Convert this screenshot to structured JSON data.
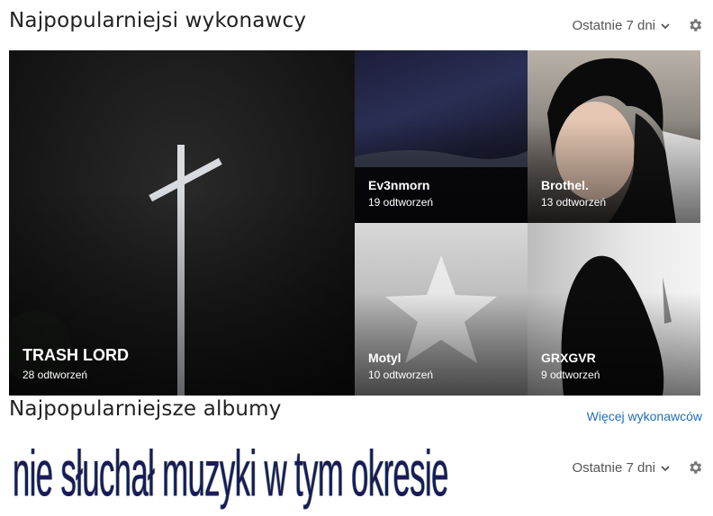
{
  "artists_section": {
    "title": "Najpopularniejsi wykonawcy",
    "period_label": "Ostatnie 7 dni",
    "more_link": "Więcej wykonawców",
    "tiles": [
      {
        "name": "TRASH LORD",
        "plays": "28 odtworzeń"
      },
      {
        "name": "Ev3nmorn",
        "plays": "19 odtworzeń"
      },
      {
        "name": "Brothel.",
        "plays": "13 odtworzeń"
      },
      {
        "name": "Motyl",
        "plays": "10 odtworzeń"
      },
      {
        "name": "GRXGVR",
        "plays": "9 odtworzeń"
      }
    ]
  },
  "albums_section": {
    "title": "Najpopularniejsze albumy",
    "period_label": "Ostatnie 7 dni",
    "empty_message": "nie słuchał muzyki w tym okresie"
  },
  "icons": {
    "chevron": "chevron-down-icon",
    "settings": "gear-icon",
    "placeholder": "star-icon"
  }
}
